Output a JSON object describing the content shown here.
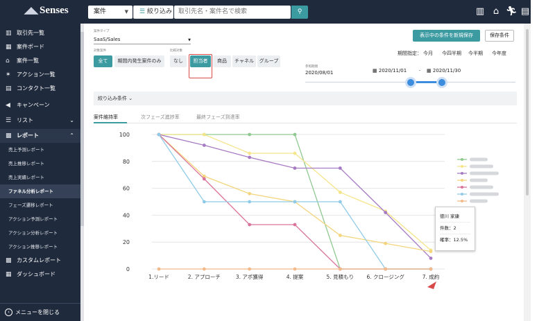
{
  "app": {
    "logo_text": "Senses"
  },
  "topbar": {
    "type_select": "案件",
    "filter_btn": "絞り込み",
    "search_placeholder": "取引先名・案件名で検索",
    "search_icon": "magnifier",
    "icons": [
      "building-icon",
      "briefcase-icon",
      "runner-icon",
      "contact-card-icon"
    ]
  },
  "sidebar": {
    "items": [
      {
        "label": "取引先一覧",
        "icon": "building"
      },
      {
        "label": "案件ボード",
        "icon": "board"
      },
      {
        "label": "案件一覧",
        "icon": "briefcase"
      },
      {
        "label": "アクション一覧",
        "icon": "runner"
      },
      {
        "label": "コンタクト一覧",
        "icon": "card"
      },
      {
        "label": "キャンペーン",
        "icon": "megaphone"
      },
      {
        "label": "リスト",
        "icon": "list",
        "arrow": "⌄"
      },
      {
        "label": "レポート",
        "icon": "chart",
        "arrow": "⌃"
      }
    ],
    "report_sub": [
      "売上予測レポート",
      "売上推移レポート",
      "売上実績レポート",
      "ファネル分析レポート",
      "フェーズ遷移レポート",
      "アクション予測レポート",
      "アクション分析レポート",
      "アクション推移レポート"
    ],
    "bottom_items": [
      {
        "label": "カスタムレポート",
        "icon": "chart"
      },
      {
        "label": "ダッシュボード",
        "icon": "grid"
      }
    ],
    "close_menu": "メニューを閉じる"
  },
  "main": {
    "case_type_label": "案件タイプ",
    "case_type_value": "SaaS/Sales",
    "target_label": "対象案件",
    "target_buttons": [
      "全て",
      "期間内発生案件のみ"
    ],
    "compare_label": "比較対象",
    "compare_buttons": [
      "なし",
      "担当者",
      "商品",
      "チャネル",
      "グループ"
    ],
    "save_new_btn": "表示中の条件を新規保存",
    "save_btn": "保存条件",
    "period_label": "期間指定：",
    "periods": [
      "今月",
      "今四半期",
      "今半期",
      "今年度"
    ],
    "ref_label": "参照期間",
    "ref_date": "2020/08/01",
    "range_start": "2020/11/01",
    "range_end": "2020/11/30",
    "filter_conditions": "絞り込み条件",
    "tabs": [
      "案件維持率",
      "次フェーズ進捗率",
      "最終フェーズ到達率"
    ]
  },
  "tooltip": {
    "name": "徳川 家康",
    "count": "件数：2",
    "rate": "確率：12.5%"
  },
  "chart_data": {
    "type": "line",
    "categories": [
      "1.リード",
      "2. アプローチ",
      "3. アポ獲得",
      "4. 提案",
      "5. 見積もり",
      "6. クロージング",
      "7. 成約"
    ],
    "ylim": [
      0,
      100
    ],
    "yticks": [
      0,
      20,
      40,
      60,
      80,
      100
    ],
    "grid": true,
    "legend_position": "right",
    "series": [
      {
        "color": "#8fc98f",
        "values": [
          100,
          100,
          100,
          100,
          0,
          0,
          0
        ]
      },
      {
        "color": "#f5e58a",
        "values": [
          100,
          100,
          86,
          86,
          57,
          43,
          14
        ]
      },
      {
        "color": "#a77bc4",
        "values": [
          100,
          92,
          83,
          75,
          75,
          42,
          8
        ]
      },
      {
        "color": "#f4d47c",
        "values": [
          100,
          69,
          56,
          50,
          25,
          19,
          13
        ]
      },
      {
        "color": "#d9739a",
        "values": [
          100,
          67,
          33,
          33,
          0,
          0,
          0
        ]
      },
      {
        "color": "#8fcbe8",
        "values": [
          100,
          50,
          50,
          50,
          50,
          0,
          0
        ]
      },
      {
        "color": "#f2b98a",
        "values": [
          0,
          0,
          0,
          0,
          0,
          0,
          0
        ]
      }
    ]
  }
}
